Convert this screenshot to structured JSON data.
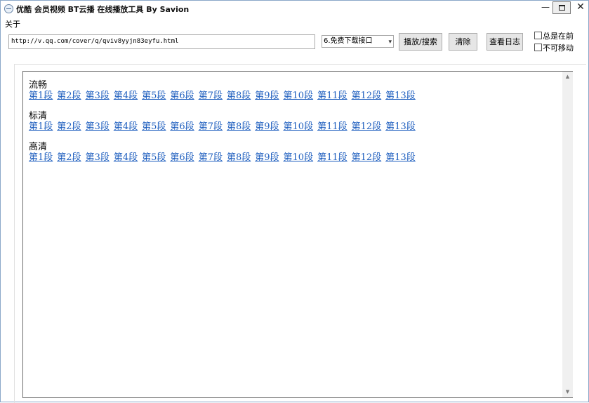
{
  "window": {
    "title": "优酷 会员视频 BT云播 在线播放工具 By Savion",
    "minimize_glyph": "—",
    "close_glyph": "✕"
  },
  "menu": {
    "about": "关于"
  },
  "toolbar": {
    "url_value": "http://v.qq.com/cover/q/qviv8yyjn83eyfu.html",
    "source_select": "6.免费下载接口",
    "play_search_label": "播放/搜索",
    "clear_label": "清除",
    "view_log_label": "查看日志",
    "always_on_top_label": "总是在前",
    "not_movable_label": "不可移动"
  },
  "content": {
    "sections": [
      {
        "title": "流畅",
        "links": [
          "第1段",
          "第2段",
          "第3段",
          "第4段",
          "第5段",
          "第6段",
          "第7段",
          "第8段",
          "第9段",
          "第10段",
          "第11段",
          "第12段",
          "第13段"
        ]
      },
      {
        "title": "标清",
        "links": [
          "第1段",
          "第2段",
          "第3段",
          "第4段",
          "第5段",
          "第6段",
          "第7段",
          "第8段",
          "第9段",
          "第10段",
          "第11段",
          "第12段",
          "第13段"
        ]
      },
      {
        "title": "高清",
        "links": [
          "第1段",
          "第2段",
          "第3段",
          "第4段",
          "第5段",
          "第6段",
          "第7段",
          "第8段",
          "第9段",
          "第10段",
          "第11段",
          "第12段",
          "第13段"
        ]
      }
    ]
  },
  "colors": {
    "link": "#1f5fbf"
  }
}
